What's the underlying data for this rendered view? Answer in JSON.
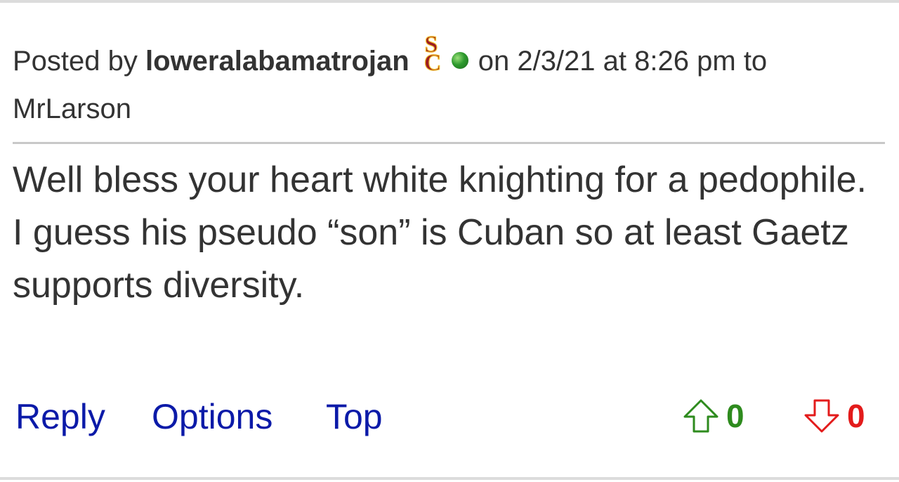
{
  "post": {
    "posted_by_label": "Posted by",
    "author": "loweralabamatrojan",
    "team_logo_text": "SC",
    "on_label": "on",
    "date": "2/3/21",
    "at_label": "at",
    "time": "8:26 pm",
    "to_label": "to",
    "recipient": "MrLarson",
    "body": "Well bless your heart white knighting for a pedophile. I guess his pseudo “son” is Cuban so at least Gaetz supports diversity."
  },
  "actions": {
    "reply_label": "Reply",
    "options_label": "Options",
    "top_label": "Top"
  },
  "votes": {
    "upvote_count": "0",
    "downvote_count": "0"
  },
  "colors": {
    "link": "#0b1aa8",
    "upvote": "#2e8b1e",
    "downvote": "#e31b1b",
    "logo": "#9d1c20",
    "logo_gold": "#f2c230",
    "online": "#2e9a2e"
  }
}
